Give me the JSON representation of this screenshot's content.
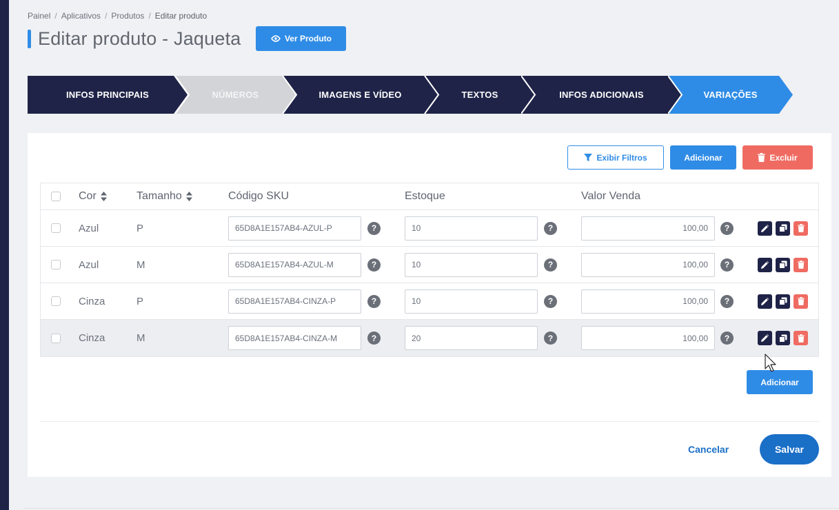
{
  "breadcrumb": [
    "Painel",
    "Aplicativos",
    "Produtos",
    "Editar produto"
  ],
  "breadcrumb_sep": "/",
  "page_title": "Editar produto - Jaqueta",
  "view_button": "Ver Produto",
  "steps": [
    {
      "label": "INFOS PRINCIPAIS",
      "state": "done"
    },
    {
      "label": "NÚMEROS",
      "state": "disabled"
    },
    {
      "label": "IMAGENS E VÍDEO",
      "state": "done"
    },
    {
      "label": "TEXTOS",
      "state": "done"
    },
    {
      "label": "INFOS ADICIONAIS",
      "state": "done"
    },
    {
      "label": "VARIAÇÕES",
      "state": "active"
    }
  ],
  "toolbar": {
    "filter": "Exibir Filtros",
    "add": "Adicionar",
    "delete": "Excluir"
  },
  "table": {
    "headers": {
      "color": "Cor",
      "size": "Tamanho",
      "sku": "Código SKU",
      "stock": "Estoque",
      "price": "Valor Venda"
    },
    "rows": [
      {
        "color": "Azul",
        "size": "P",
        "sku": "65D8A1E157AB4-AZUL-P",
        "stock": "10",
        "price": "100,00"
      },
      {
        "color": "Azul",
        "size": "M",
        "sku": "65D8A1E157AB4-AZUL-M",
        "stock": "10",
        "price": "100,00"
      },
      {
        "color": "Cinza",
        "size": "P",
        "sku": "65D8A1E157AB4-CINZA-P",
        "stock": "10",
        "price": "100,00"
      },
      {
        "color": "Cinza",
        "size": "M",
        "sku": "65D8A1E157AB4-CINZA-M",
        "stock": "20",
        "price": "100,00"
      }
    ],
    "help": "?"
  },
  "add_bottom": "Adicionar",
  "footer": {
    "cancel": "Cancelar",
    "save": "Salvar"
  },
  "colors": {
    "navy": "#1f2347",
    "blue": "#2f8ce6",
    "red": "#ef6b62",
    "gray_step": "#d3d4d7",
    "dark_blue": "#1a6fc7"
  },
  "icons": [
    "eye-icon",
    "filter-icon",
    "trash-icon",
    "sort-icon",
    "help-icon",
    "pencil-icon",
    "copy-icon",
    "cursor-icon"
  ]
}
